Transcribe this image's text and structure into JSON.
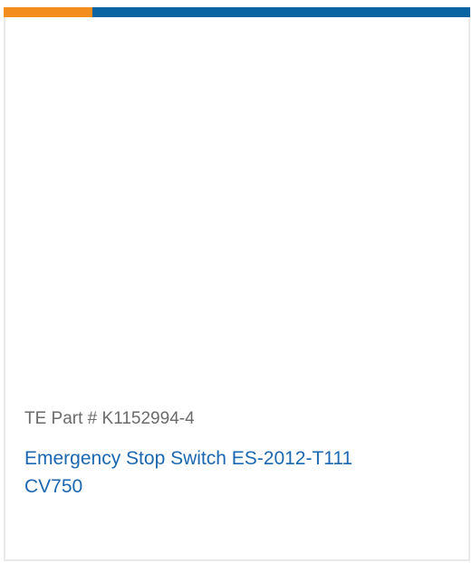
{
  "card": {
    "part_number": "TE Part # K1152994-4",
    "title_line1": "Emergency Stop Switch ES-2012-T111",
    "title_line2": "CV750"
  },
  "colors": {
    "accent_bar": "#f28d1e",
    "primary_bar": "#0a64a4",
    "link": "#1b67b0",
    "meta_text": "#6b6b6b",
    "border": "#e9e9e9"
  }
}
